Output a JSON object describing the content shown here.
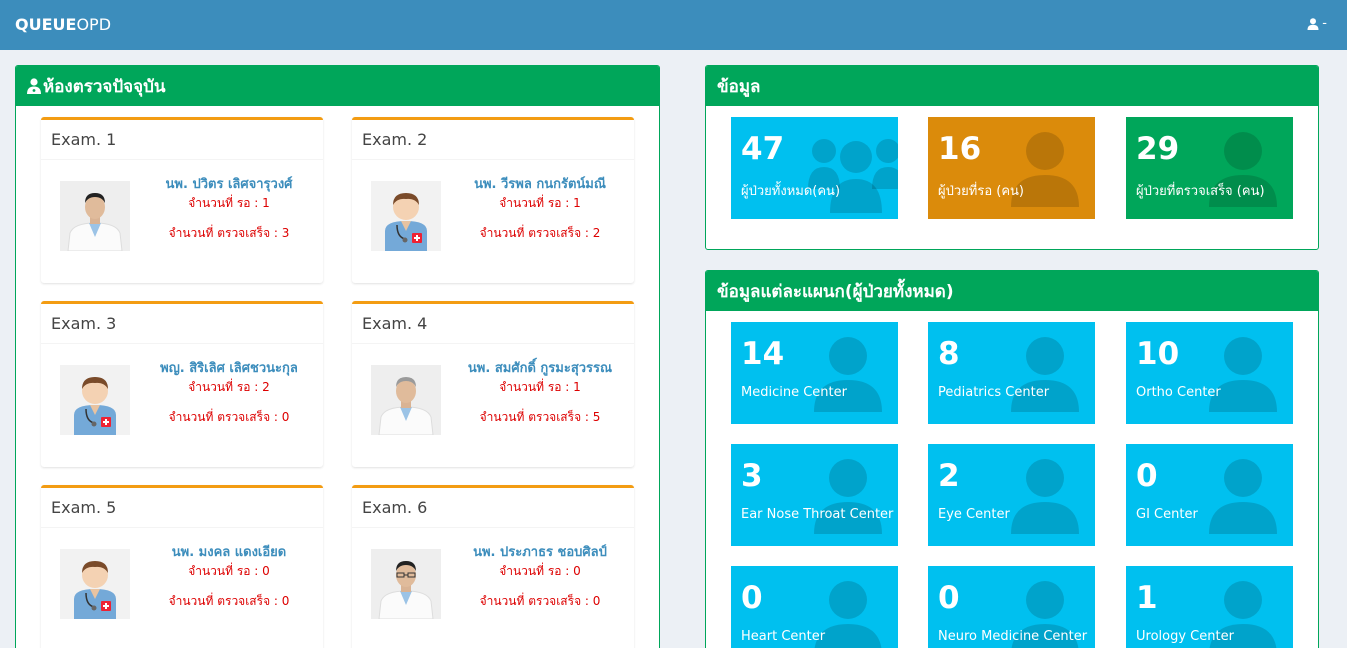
{
  "navbar": {
    "brand_bold": "QUEUE",
    "brand_rest": "OPD",
    "user_label": "-"
  },
  "left_panel": {
    "title": "ห้องตรวจปัจจุบัน"
  },
  "exams": [
    {
      "title": "Exam. 1",
      "doctor": "นพ. ปวิตร เลิศจารุวงศ์",
      "wait": "จำนวนที่ รอ : 1",
      "done": "จำนวนที่ ตรวจเสร็จ : 3"
    },
    {
      "title": "Exam. 2",
      "doctor": "นพ. วีรพล กนกรัตน์มณี",
      "wait": "จำนวนที่ รอ : 1",
      "done": "จำนวนที่ ตรวจเสร็จ : 2"
    },
    {
      "title": "Exam. 3",
      "doctor": "พญ. สิริเลิศ เลิศชวนะกุล",
      "wait": "จำนวนที่ รอ : 2",
      "done": "จำนวนที่ ตรวจเสร็จ : 0"
    },
    {
      "title": "Exam. 4",
      "doctor": "นพ. สมศักดิ์ กูรมะสุวรรณ",
      "wait": "จำนวนที่ รอ : 1",
      "done": "จำนวนที่ ตรวจเสร็จ : 5"
    },
    {
      "title": "Exam. 5",
      "doctor": "นพ. มงคล แดงเอียด",
      "wait": "จำนวนที่ รอ : 0",
      "done": "จำนวนที่ ตรวจเสร็จ : 0"
    },
    {
      "title": "Exam. 6",
      "doctor": "นพ. ประภาธร ชอบศิลป์",
      "wait": "จำนวนที่ รอ : 0",
      "done": "จำนวนที่ ตรวจเสร็จ : 0"
    }
  ],
  "info_panel": {
    "title": "ข้อมูล",
    "stats": [
      {
        "value": "47",
        "label": "ผู้ป่วยทั้งหมด(คน)",
        "color": "#00c0ef",
        "icon": "users-icon"
      },
      {
        "value": "16",
        "label": "ผู้ป่วยที่รอ (คน)",
        "color": "#db8b0b",
        "icon": "user-icon"
      },
      {
        "value": "29",
        "label": "ผู้ป่วยที่ตรวจเสร็จ (คน)",
        "color": "#00a65a",
        "icon": "user-icon"
      }
    ]
  },
  "dept_panel": {
    "title": "ข้อมูลแต่ละแผนก(ผู้ป่วยทั้งหมด)",
    "departments": [
      {
        "value": "14",
        "label": "Medicine Center"
      },
      {
        "value": "8",
        "label": "Pediatrics Center"
      },
      {
        "value": "10",
        "label": "Ortho Center"
      },
      {
        "value": "3",
        "label": "Ear Nose Throat Center"
      },
      {
        "value": "2",
        "label": "Eye Center"
      },
      {
        "value": "0",
        "label": "GI Center"
      },
      {
        "value": "0",
        "label": "Heart Center"
      },
      {
        "value": "0",
        "label": "Neuro Medicine Center"
      },
      {
        "value": "1",
        "label": "Urology Center"
      }
    ]
  },
  "colors": {
    "navbar": "#3c8dbc",
    "box_header": "#00a65a",
    "exam_border": "#f39c12",
    "doctor_name": "#3c8dbc",
    "counts": "#dd0000",
    "aqua": "#00c0ef"
  }
}
